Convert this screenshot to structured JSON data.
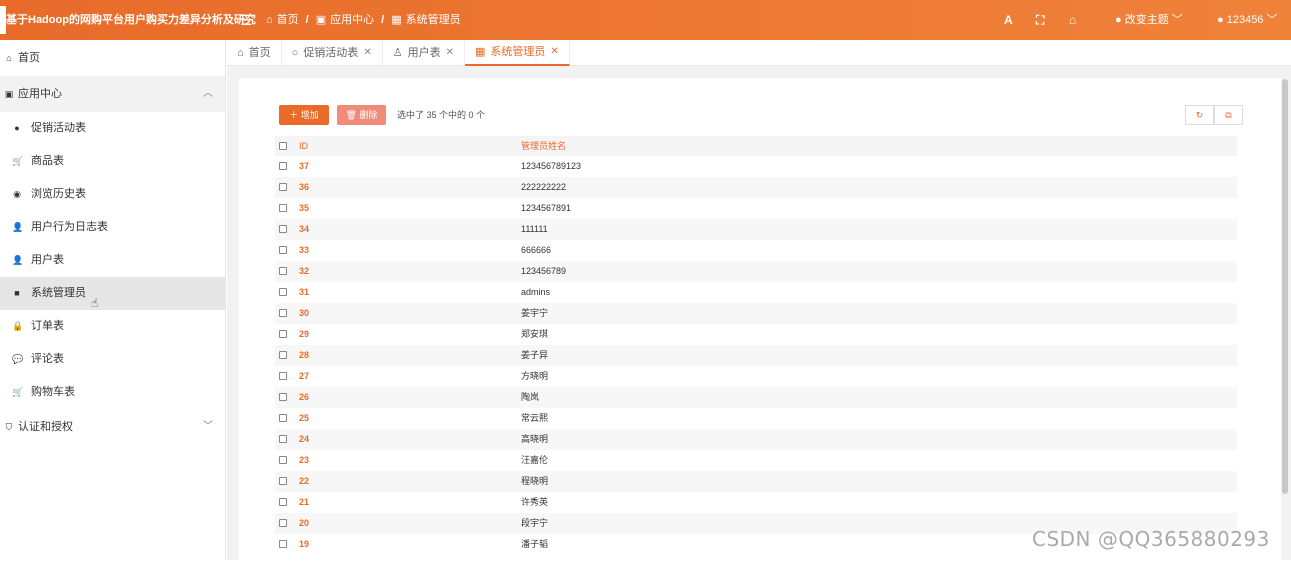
{
  "header": {
    "app_title": "基于Hadoop的网购平台用户购买力差异分析及研究",
    "breadcrumbs": [
      "首页",
      "应用中心",
      "系统管理员"
    ],
    "theme_label": "改变主题",
    "user_label": "123456"
  },
  "sidebar": {
    "items": [
      {
        "label": "首页",
        "icon": "home-icon"
      },
      {
        "label": "应用中心",
        "icon": "app-icon"
      },
      {
        "label": "促销活动表",
        "icon": "circle-icon"
      },
      {
        "label": "商品表",
        "icon": "cart-icon"
      },
      {
        "label": "浏览历史表",
        "icon": "eye-icon"
      },
      {
        "label": "用户行为日志表",
        "icon": "user-icon"
      },
      {
        "label": "用户表",
        "icon": "user-icon"
      },
      {
        "label": "系统管理员",
        "icon": "square-icon"
      },
      {
        "label": "订单表",
        "icon": "bag-icon"
      },
      {
        "label": "评论表",
        "icon": "comment-icon"
      },
      {
        "label": "购物车表",
        "icon": "cart-icon"
      },
      {
        "label": "认证和授权",
        "icon": "shield-icon"
      }
    ]
  },
  "tabs": [
    {
      "label": "首页"
    },
    {
      "label": "促销活动表"
    },
    {
      "label": "用户表"
    },
    {
      "label": "系统管理员"
    }
  ],
  "toolbar": {
    "add_label": "增加",
    "delete_label": "删除",
    "selection_info": "选中了 35 个中的 0 个"
  },
  "table": {
    "columns": [
      "ID",
      "管理员姓名"
    ],
    "rows": [
      {
        "id": "37",
        "name": "123456789123"
      },
      {
        "id": "36",
        "name": "222222222"
      },
      {
        "id": "35",
        "name": "1234567891"
      },
      {
        "id": "34",
        "name": "111111"
      },
      {
        "id": "33",
        "name": "666666"
      },
      {
        "id": "32",
        "name": "123456789"
      },
      {
        "id": "31",
        "name": "admins"
      },
      {
        "id": "30",
        "name": "姜宇宁"
      },
      {
        "id": "29",
        "name": "郑安琪"
      },
      {
        "id": "28",
        "name": "姜子异"
      },
      {
        "id": "27",
        "name": "方晓明"
      },
      {
        "id": "26",
        "name": "陶岚"
      },
      {
        "id": "25",
        "name": "常云熙"
      },
      {
        "id": "24",
        "name": "高晓明"
      },
      {
        "id": "23",
        "name": "汪嘉伦"
      },
      {
        "id": "22",
        "name": "程晓明"
      },
      {
        "id": "21",
        "name": "许秀英"
      },
      {
        "id": "20",
        "name": "段宇宁"
      },
      {
        "id": "19",
        "name": "潘子韬"
      }
    ]
  },
  "watermark": "CSDN @QQ365880293",
  "colors": {
    "accent": "#e86b2a",
    "delete": "#f08b7a"
  }
}
